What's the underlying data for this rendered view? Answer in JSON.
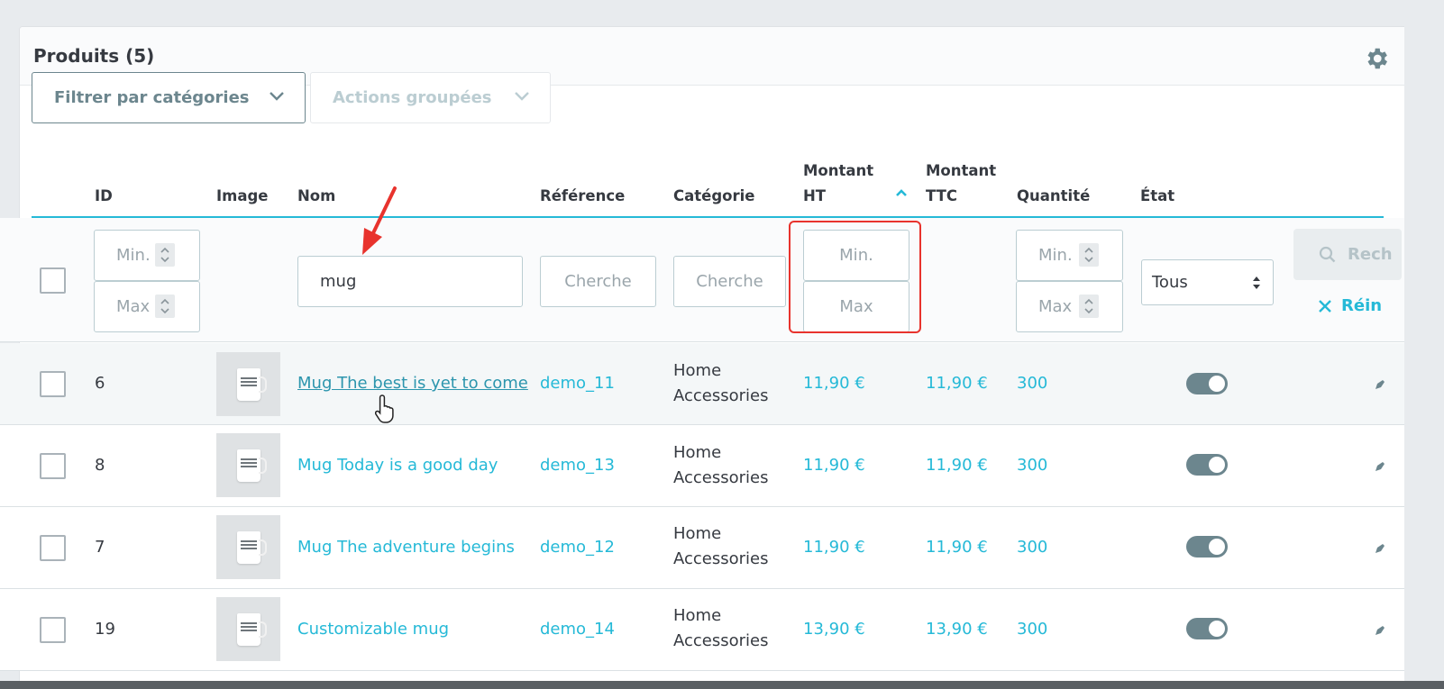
{
  "panel": {
    "title": "Produits (5)"
  },
  "toolbar": {
    "filter_categories": "Filtrer par catégories",
    "bulk_actions": "Actions groupées"
  },
  "columns": {
    "id": "ID",
    "image": "Image",
    "name": "Nom",
    "reference": "Référence",
    "category": "Catégorie",
    "price_ht_1": "Montant",
    "price_ht_2": "HT",
    "price_ttc_1": "Montant",
    "price_ttc_2": "TTC",
    "quantity": "Quantité",
    "status": "État"
  },
  "filters": {
    "id_min": "Min.",
    "id_max": "Max",
    "name_value": "mug",
    "reference_placeholder": "Cherche",
    "category_placeholder": "Cherche",
    "price_min": "Min.",
    "price_max": "Max",
    "qty_min": "Min.",
    "qty_max": "Max",
    "status_selected": "Tous",
    "search_label": "Rech",
    "reset_label": "Réin"
  },
  "rows": [
    {
      "id": "6",
      "name": "Mug The best is yet to come",
      "reference": "demo_11",
      "category_1": "Home",
      "category_2": "Accessories",
      "price_ht": "11,90 €",
      "price_ttc": "11,90 €",
      "quantity": "300"
    },
    {
      "id": "8",
      "name": "Mug Today is a good day",
      "reference": "demo_13",
      "category_1": "Home",
      "category_2": "Accessories",
      "price_ht": "11,90 €",
      "price_ttc": "11,90 €",
      "quantity": "300"
    },
    {
      "id": "7",
      "name": "Mug The adventure begins",
      "reference": "demo_12",
      "category_1": "Home",
      "category_2": "Accessories",
      "price_ht": "11,90 €",
      "price_ttc": "11,90 €",
      "quantity": "300"
    },
    {
      "id": "19",
      "name": "Customizable mug",
      "reference": "demo_14",
      "category_1": "Home",
      "category_2": "Accessories",
      "price_ht": "13,90 €",
      "price_ttc": "13,90 €",
      "quantity": "300"
    }
  ],
  "colors": {
    "accent": "#25b9d7",
    "annotation": "#e8332d",
    "toggle_on": "#6c868e"
  }
}
